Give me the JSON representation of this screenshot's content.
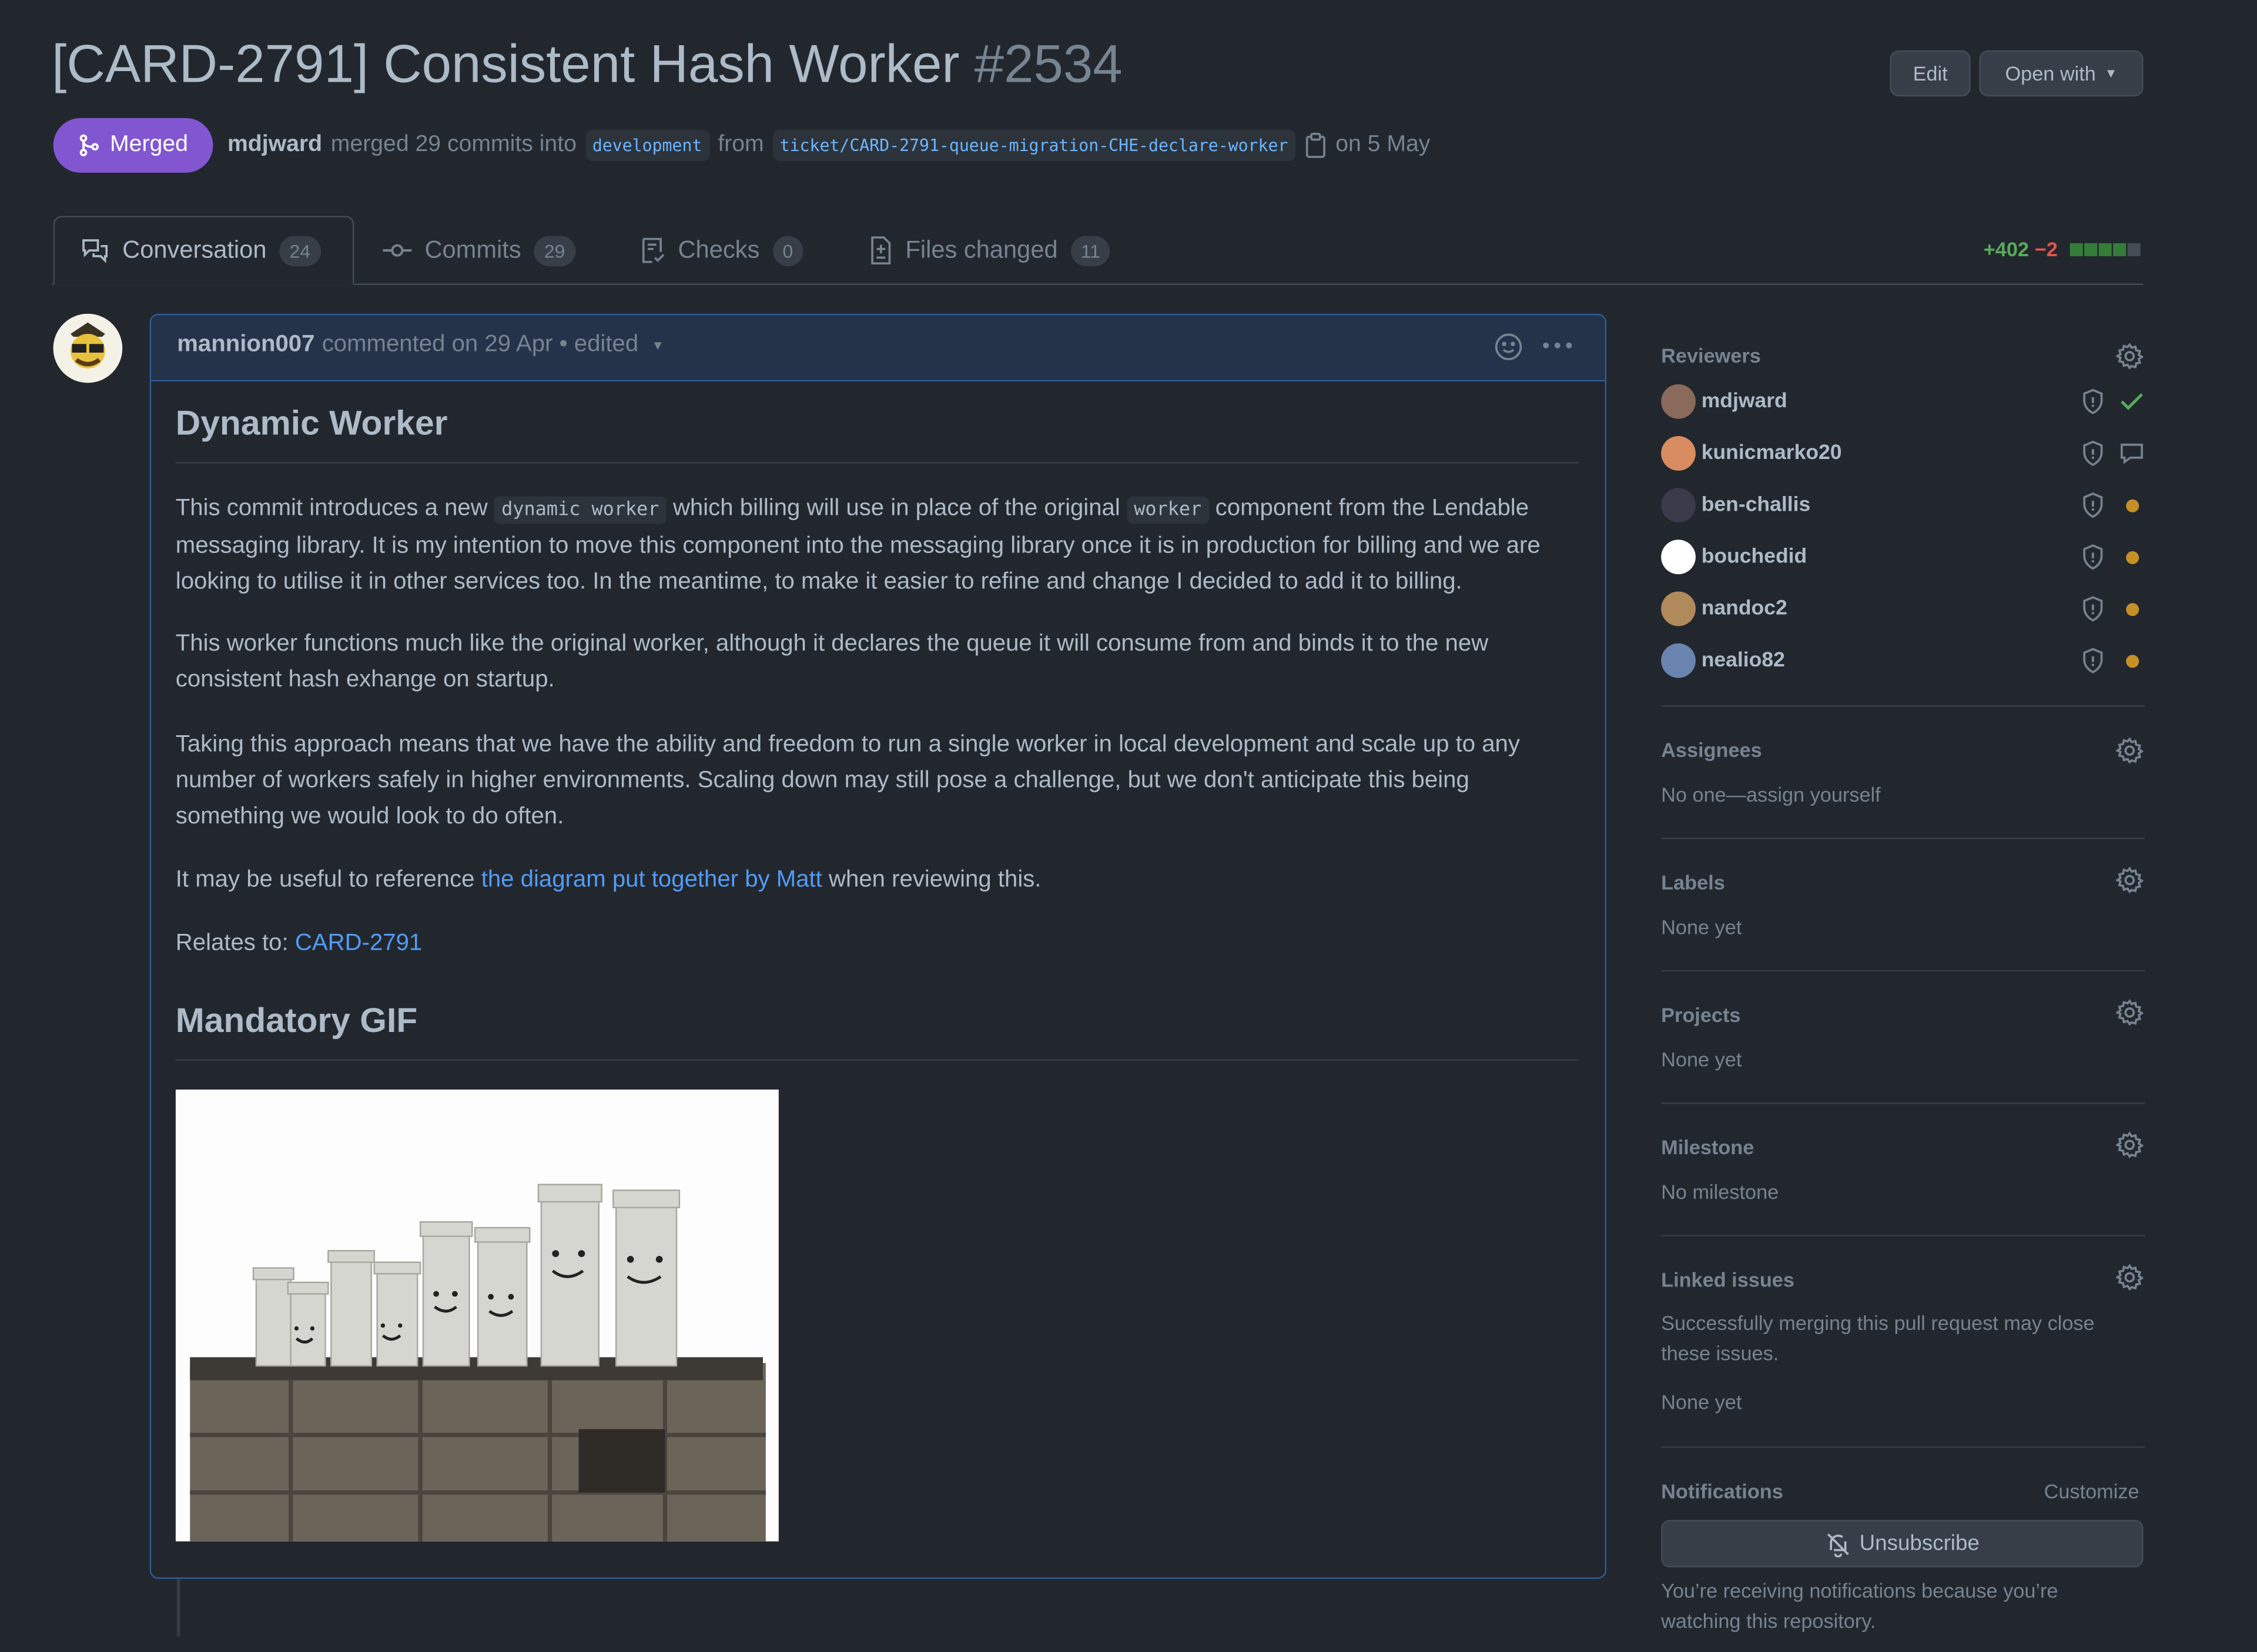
{
  "header": {
    "title": "[CARD-2791] Consistent Hash Worker",
    "number": "#2534",
    "edit_label": "Edit",
    "open_with_label": "Open with",
    "state_label": "Merged",
    "merger": "mdjward",
    "merge_text": "merged 29 commits into",
    "base_branch": "development",
    "from_text": "from",
    "head_branch": "ticket/CARD-2791-queue-migration-CHE-declare-worker",
    "date_text": "on 5 May"
  },
  "tabs": [
    {
      "label": "Conversation",
      "count": "24",
      "icon": "comment-discussion-icon"
    },
    {
      "label": "Commits",
      "count": "29",
      "icon": "git-commit-icon"
    },
    {
      "label": "Checks",
      "count": "0",
      "icon": "checklist-icon"
    },
    {
      "label": "Files changed",
      "count": "11",
      "icon": "file-diff-icon"
    }
  ],
  "diffstat": {
    "additions": "+402",
    "deletions": "−2",
    "colors": [
      "#347d39",
      "#347d39",
      "#347d39",
      "#347d39",
      "#444c56"
    ]
  },
  "comment": {
    "author": "mannion007",
    "meta": "commented on 29 Apr • edited",
    "heading1": "Dynamic Worker",
    "p1_a": "This commit introduces a new",
    "p1_code1": "dynamic worker",
    "p1_b": "which billing will use in place of the original",
    "p1_code2": "worker",
    "p1_c": "component from the Lendable messaging library. It is my intention to move this component into the messaging library once it is in production for billing and we are looking to utilise it in other services too. In the meantime, to make it easier to refine and change I decided to add it to billing.",
    "p2": "This worker functions much like the original worker, although it declares the queue it will consume from and binds it to the new consistent hash exhange on startup.",
    "p3": "Taking this approach means that we have the ability and freedom to run a single worker in local development and scale up to any number of workers safely in higher environments. Scaling down may still pose a challenge, but we don't anticipate this being something we would look to do often.",
    "p4_a": "It may be useful to reference",
    "p4_link": "the diagram put together by Matt",
    "p4_b": "when reviewing this.",
    "p5_a": "Relates to:",
    "p5_link": "CARD-2791",
    "heading2": "Mandatory GIF"
  },
  "sidebar": {
    "reviewers_title": "Reviewers",
    "reviewers": [
      {
        "name": "mdjward",
        "status": "approved",
        "avatar_color": "#8a6a5a"
      },
      {
        "name": "kunicmarko20",
        "status": "commented",
        "avatar_color": "#d98c5f"
      },
      {
        "name": "ben-challis",
        "status": "pending",
        "avatar_color": "#3a3a4a"
      },
      {
        "name": "bouchedid",
        "status": "pending",
        "avatar_color": "#ffffff"
      },
      {
        "name": "nandoc2",
        "status": "pending",
        "avatar_color": "#b08a5a"
      },
      {
        "name": "nealio82",
        "status": "pending",
        "avatar_color": "#6a84b0"
      }
    ],
    "assignees_title": "Assignees",
    "assignees_value": "No one—assign yourself",
    "labels_title": "Labels",
    "labels_value": "None yet",
    "projects_title": "Projects",
    "projects_value": "None yet",
    "milestone_title": "Milestone",
    "milestone_value": "No milestone",
    "linked_title": "Linked issues",
    "linked_desc": "Successfully merging this pull request may close these issues.",
    "linked_value": "None yet",
    "notifications_title": "Notifications",
    "customize_label": "Customize",
    "unsubscribe_label": "Unsubscribe",
    "notifications_reason": "You’re receiving notifications because you’re watching this repository."
  }
}
